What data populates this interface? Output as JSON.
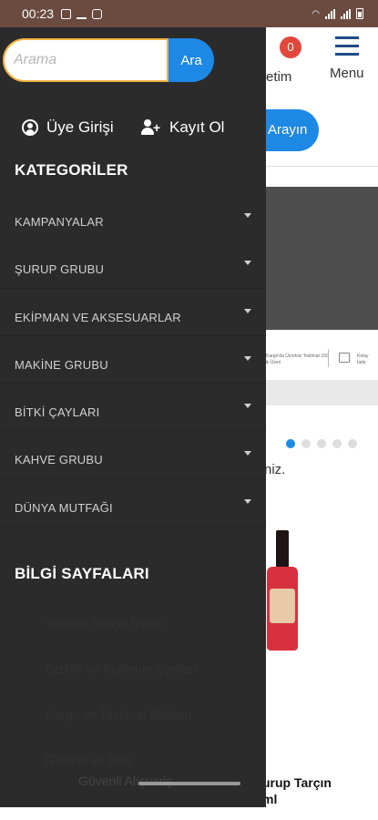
{
  "status_bar": {
    "time": "00:23",
    "icons": [
      "image-icon",
      "download-check-icon",
      "instagram-icon"
    ],
    "right_icons": [
      "wifi-icon",
      "signal-icon",
      "signal-icon",
      "battery-icon"
    ]
  },
  "background": {
    "cart_count": "0",
    "cart_label": "etim",
    "menu_label": "Menu",
    "search_button": "Arayın",
    "promo_text_1": "Kargo'da Ücretsiz Teslimat 150 ₺ Üzeri",
    "promo_text_2": "Kolay İade",
    "partial_text": "niz.",
    "product_title_line1": "urup Tarçın",
    "product_title_line2": "ml",
    "carousel_dots": 5,
    "carousel_active_index": 0
  },
  "drawer": {
    "search": {
      "placeholder": "Arama",
      "value": "",
      "button_label": "Ara"
    },
    "auth": {
      "login_label": "Üye Girişi",
      "register_label": "Kayıt Ol"
    },
    "categories_title": "KATEGORİLER",
    "categories": [
      {
        "label": "KAMPANYALAR"
      },
      {
        "label": "ŞURUP GRUBU"
      },
      {
        "label": "EKİPMAN VE AKSESUARLAR"
      },
      {
        "label": "MAKİNE GRUBU"
      },
      {
        "label": "BİTKİ ÇAYLARI"
      },
      {
        "label": "KAHVE GRUBU"
      },
      {
        "label": "DÜNYA MUTFAĞI"
      }
    ],
    "info_title": "BİLGİ SAYFALARI",
    "info_pages": [
      {
        "label": "Şirketin Satışa İlişkin"
      },
      {
        "label": "Gizlilik ve Kullanım Şartları"
      },
      {
        "label": "Kargo ve Teslimat Bilgileri"
      },
      {
        "label": "Garanti ve İade"
      }
    ],
    "info_last": "Güvenli Alışveriş"
  },
  "colors": {
    "status_bar": "#6b4a40",
    "drawer_bg": "#2b2b2b",
    "accent_blue": "#1e88e5",
    "search_border": "#f0b343",
    "badge_red": "#e2473b"
  }
}
